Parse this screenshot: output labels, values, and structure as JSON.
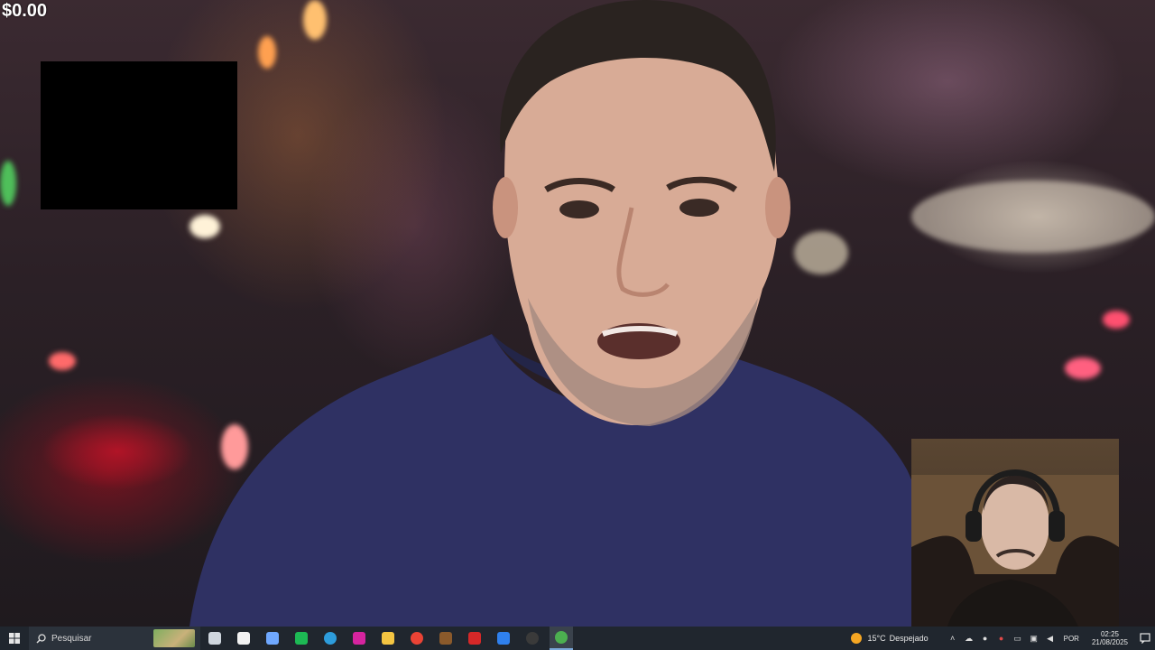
{
  "overlay": {
    "price": "$0.00"
  },
  "taskbar": {
    "search_label": "Pesquisar",
    "apps": [
      {
        "icon": "task-view-icon",
        "color": "#cfd6de"
      },
      {
        "icon": "capcut-icon",
        "color": "#f2f2f2"
      },
      {
        "icon": "copilot-icon",
        "color": "#6fa8ff"
      },
      {
        "icon": "spotify-icon",
        "color": "#1db954"
      },
      {
        "icon": "edge-icon",
        "color": "#2d9cdb"
      },
      {
        "icon": "instagram-icon",
        "color": "#d6249f"
      },
      {
        "icon": "file-explorer-icon",
        "color": "#f4c542"
      },
      {
        "icon": "chrome-icon",
        "color": "#ea4335"
      },
      {
        "icon": "minecraft-icon",
        "color": "#8b5a2b"
      },
      {
        "icon": "app-red-icon",
        "color": "#d62828"
      },
      {
        "icon": "trello-icon",
        "color": "#2f80ed"
      },
      {
        "icon": "obs-icon",
        "color": "#3a3a3a"
      },
      {
        "icon": "chrome-dev-icon",
        "color": "#4caf50"
      }
    ],
    "weather": {
      "temperature": "15°C",
      "condition": "Despejado"
    },
    "language": "POR",
    "time": "02:25",
    "date": "21/08/2025"
  }
}
